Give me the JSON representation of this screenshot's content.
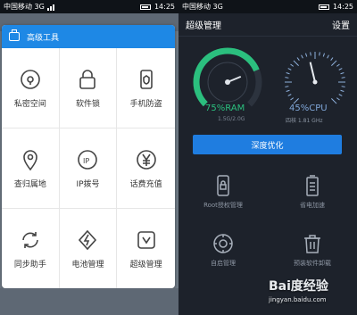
{
  "left": {
    "status": {
      "carrier": "中国移动 3G",
      "time": "14:25"
    },
    "bg_title": "",
    "panel": {
      "title": "高级工具",
      "items": [
        {
          "label": "私密空间",
          "icon": "lock-circle-icon"
        },
        {
          "label": "软件锁",
          "icon": "padlock-icon"
        },
        {
          "label": "手机防盗",
          "icon": "phone-shield-icon"
        },
        {
          "label": "查归属地",
          "icon": "location-pin-icon"
        },
        {
          "label": "IP拨号",
          "icon": "ip-icon"
        },
        {
          "label": "话费充值",
          "icon": "yuan-icon"
        },
        {
          "label": "同步助手",
          "icon": "sync-icon"
        },
        {
          "label": "电池管理",
          "icon": "battery-bolt-icon"
        },
        {
          "label": "超级管理",
          "icon": "super-manage-icon"
        }
      ]
    }
  },
  "right": {
    "status": {
      "carrier": "中国移动 3G",
      "time": "14:25"
    },
    "header": {
      "title": "超级管理",
      "settings": "设置"
    },
    "ram": {
      "value": "75%RAM",
      "sub": "1.5G/2.0G",
      "percent": 75
    },
    "cpu": {
      "value": "45%CPU",
      "sub": "四核 1.81 GHz",
      "percent": 45
    },
    "optimize_button": "深度优化",
    "tools": [
      {
        "label": "Root授权管理",
        "icon": "phone-lock-icon"
      },
      {
        "label": "省电加速",
        "icon": "battery-icon"
      },
      {
        "label": "自启管理",
        "icon": "gear-icon"
      },
      {
        "label": "预装软件卸载",
        "icon": "trash-icon"
      }
    ]
  },
  "watermark": {
    "text": "Bai度经验",
    "sub": "jingyan.baidu.com"
  },
  "colors": {
    "accent": "#1e88e5",
    "ram": "#2bbf7e",
    "cpu": "#7fa6d8",
    "dark_bg": "#1d222b"
  }
}
